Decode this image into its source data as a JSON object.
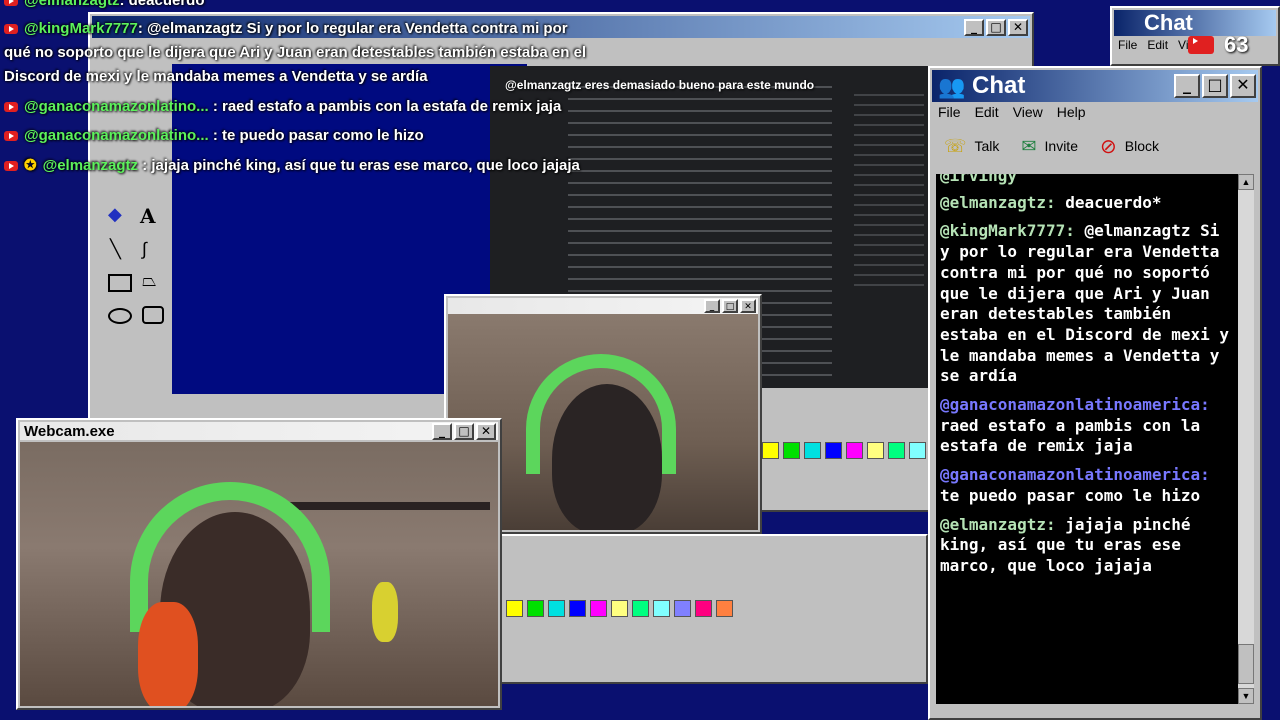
{
  "overlay_chat": [
    {
      "user": "@elmanzagtz",
      "text": ": deacuerdo"
    },
    {
      "user": "@kingMark7777",
      "text": ": @elmanzagtz Si y por lo regular era Vendetta contra mi por"
    },
    {
      "user": "",
      "text": "qué no soporto que le dijera que Ari y Juan eran detestables también estaba en el"
    },
    {
      "user": "",
      "text": "Discord de mexi y le mandaba memes a Vendetta y se ardía"
    },
    {
      "user": "@ganaconamazonlatino...",
      "text": " : raed estafo a pambis con la estafa de remix jaja"
    },
    {
      "user": "@ganaconamazonlatino...",
      "text": " : te puedo pasar como le hizo"
    },
    {
      "user": "@elmanzagtz",
      "text": " : jajaja pinché king, así que tu eras ese marco, que loco jajaja"
    }
  ],
  "browser_overlay_text": "@elmanzagtz eres demasiado bueno para este mundo",
  "webcam_window": {
    "title": "Webcam.exe"
  },
  "chat_window": {
    "title": "Chat",
    "menu": [
      "File",
      "Edit",
      "View",
      "Help"
    ],
    "tools": [
      {
        "label": "Talk",
        "icon": "talk-icon"
      },
      {
        "label": "Invite",
        "icon": "invite-icon"
      },
      {
        "label": "Block",
        "icon": "block-icon"
      }
    ],
    "messages": [
      {
        "user": "@irvingy",
        "text": ""
      },
      {
        "user": "@elmanzagtz:",
        "text": " deacuerdo*"
      },
      {
        "user": "@kingMark7777:",
        "text": " @elmanzagtz Si y por lo regular era Vendetta contra mi por qué no soportó que le dijera que Ari y Juan eran detestables también estaba en el Discord de mexi y le mandaba memes a Vendetta y se ardía"
      },
      {
        "user": "@ganaconamazonlatinoamerica:",
        "text": " raed estafo a pambis con la estafa de remix jaja"
      },
      {
        "user": "@ganaconamazonlatinoamerica:",
        "text": " te puedo pasar como le hizo"
      },
      {
        "user": "@elmanzagtz:",
        "text": " jajaja pinché king, así que tu eras ese marco, que loco jajaja"
      }
    ]
  },
  "back_chat_window": {
    "title": "Chat",
    "menu": [
      "File",
      "Edit",
      "Vie"
    ],
    "viewer_count": "63"
  },
  "colors": {
    "desktop": "#0a1070",
    "chat_bg": "#000000",
    "username_green": "#5cf25c",
    "username_blue": "#7878ff",
    "headphones": "#5cd65c"
  }
}
